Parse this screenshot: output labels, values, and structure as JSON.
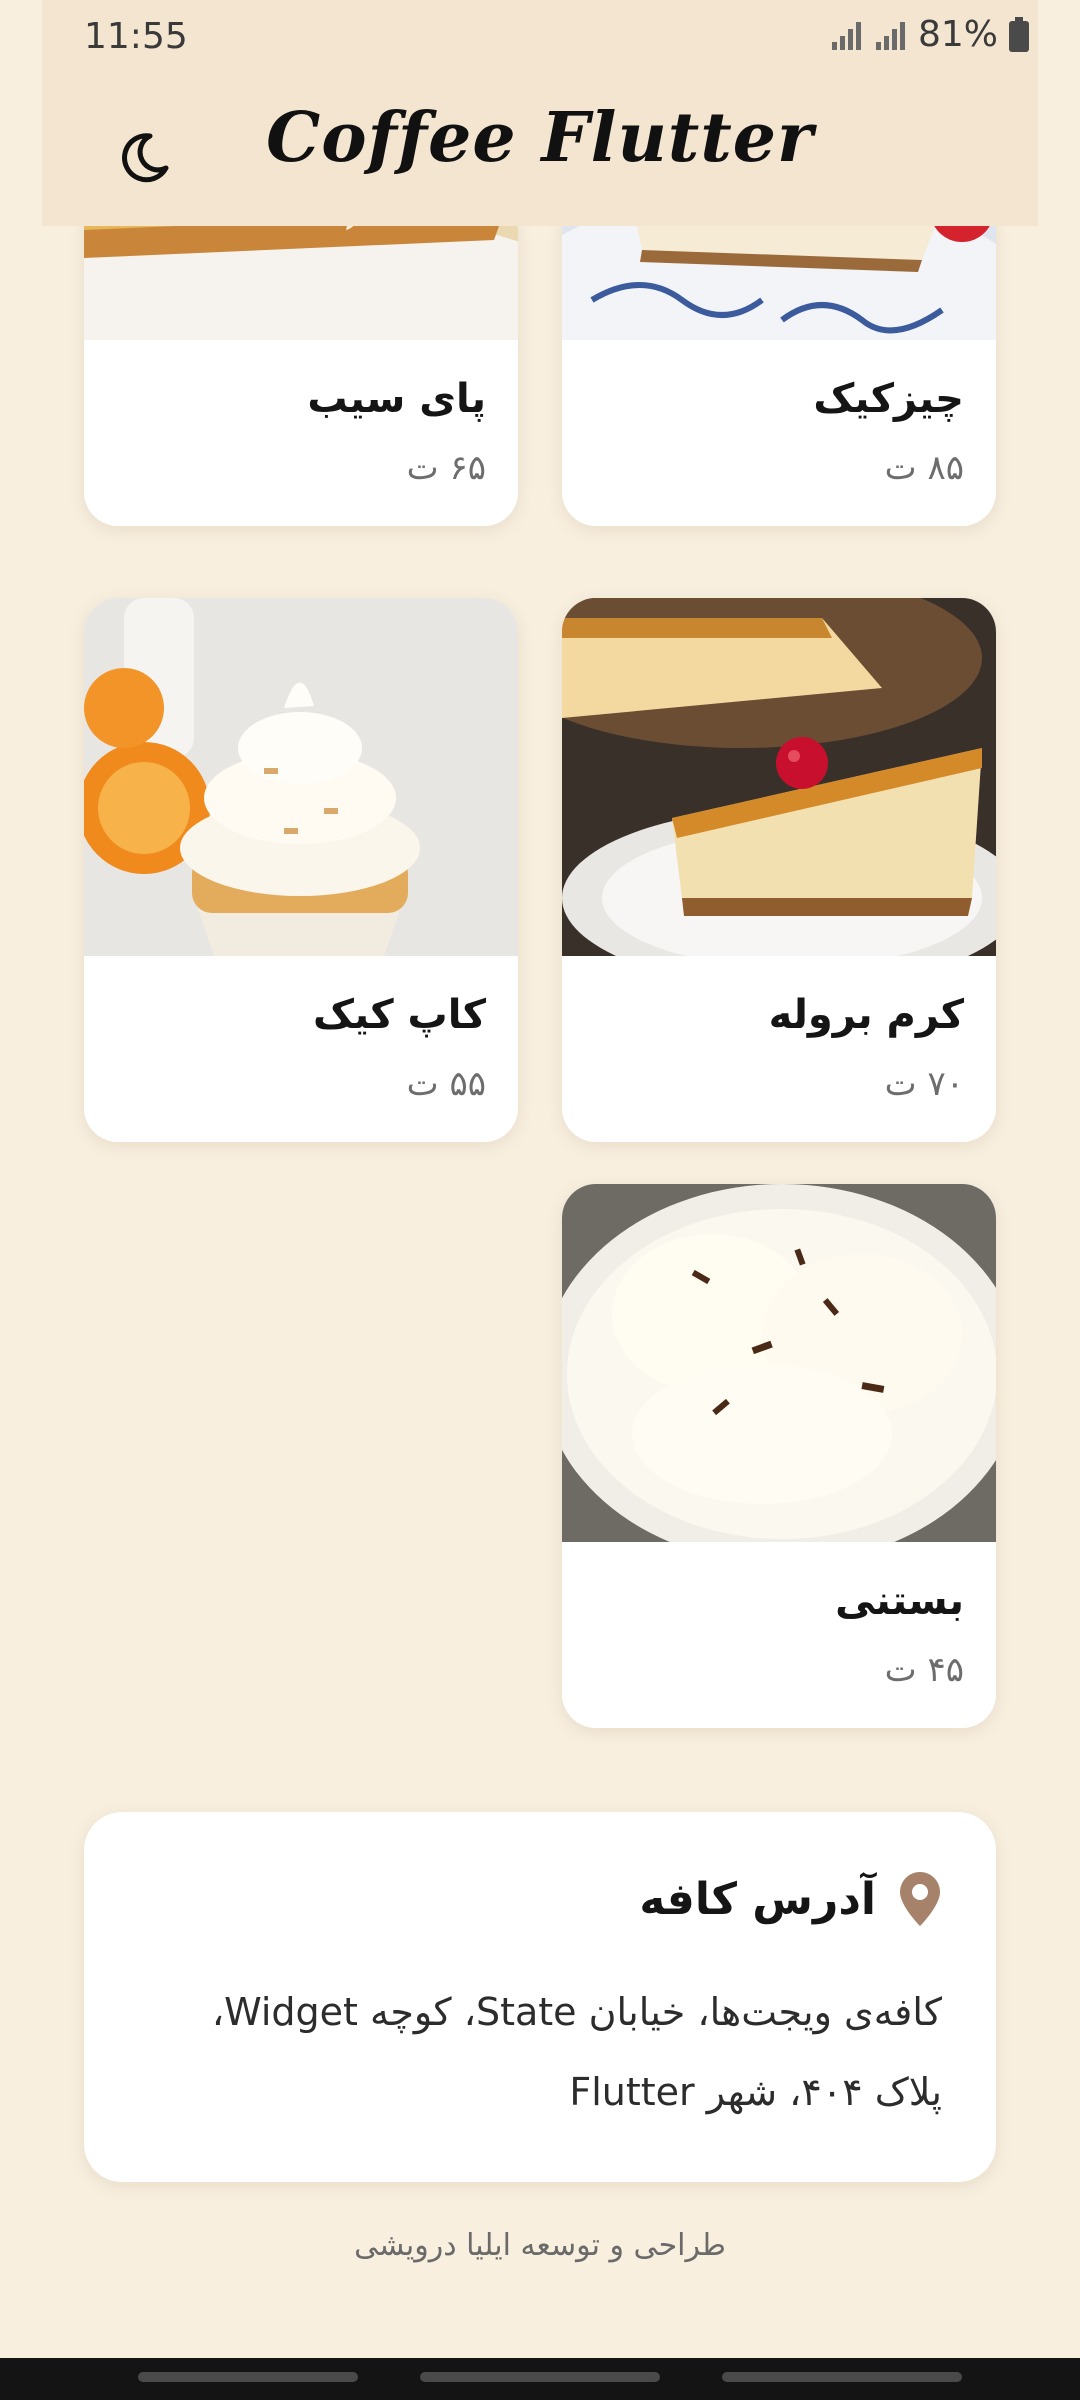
{
  "status_bar": {
    "time": "11:55",
    "battery": "81%"
  },
  "app_bar": {
    "title": "Coffee Flutter",
    "theme_icon": "moon-icon"
  },
  "menu_items": [
    {
      "name": "پای سیب",
      "price": "۶۵ ت"
    },
    {
      "name": "چیزکیک",
      "price": "۸۵ ت"
    },
    {
      "name": "کاپ کیک",
      "price": "۵۵ ت"
    },
    {
      "name": "کرم بروله",
      "price": "۷۰ ت"
    },
    {
      "name": "بستنی",
      "price": "۴۵ ت"
    }
  ],
  "address": {
    "icon": "location-pin-icon",
    "title": "آدرس کافه",
    "line1": "کافه‌ی ویجت‌ها، خیابان State، کوچه Widget،",
    "line2": "پلاک ۴۰۴، شهر Flutter"
  },
  "footer": {
    "credit": "طراحی و توسعه ایلیا درویشی"
  },
  "colors": {
    "background": "#f8efdf",
    "app_bar": "#f3e5cf",
    "pin": "#a7826a"
  }
}
